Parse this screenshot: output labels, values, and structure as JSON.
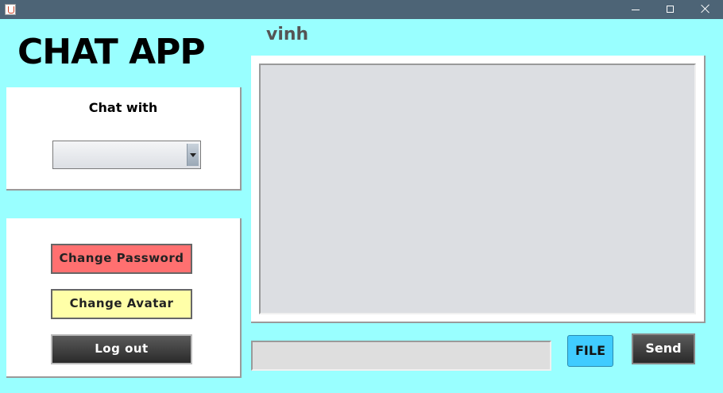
{
  "window": {
    "icon": "java-app-icon",
    "controls": [
      "minimize-icon",
      "maximize-icon",
      "close-icon"
    ]
  },
  "app": {
    "title": "CHAT APP",
    "username": "vinh"
  },
  "chat_with": {
    "label": "Chat with",
    "selected": ""
  },
  "account": {
    "change_password": "Change Password",
    "change_avatar": "Change Avatar",
    "logout": "Log out"
  },
  "composer": {
    "message_value": "",
    "file_label": "FILE",
    "send_label": "Send"
  },
  "colors": {
    "background": "#99ffff",
    "titlebar": "#4d6476",
    "change_password": "#ff7070",
    "change_avatar": "#ffffa8",
    "file_button": "#40ccff",
    "dark_button": "#3a3a3a"
  }
}
